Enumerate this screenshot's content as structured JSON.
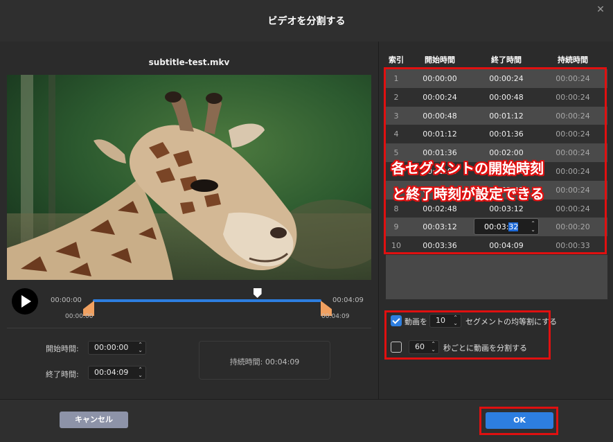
{
  "dialog": {
    "title": "ビデオを分割する",
    "close_glyph": "✕"
  },
  "preview": {
    "filename": "subtitle-test.mkv",
    "timeline_start": "00:00:00",
    "timeline_end": "00:04:09",
    "handle_start": "00:00:00",
    "handle_end": "00:04:09",
    "playhead_position": 0.72
  },
  "fields": {
    "start_label": "開始時間:",
    "start_value": "00:00:00",
    "end_label": "終了時間:",
    "end_value": "00:04:09",
    "duration_label": "持続時間:",
    "duration_value": "00:04:09"
  },
  "table": {
    "headers": [
      "索引",
      "開始時間",
      "終了時間",
      "持続時間"
    ],
    "rows": [
      {
        "idx": "1",
        "start": "00:00:00",
        "end": "00:00:24",
        "dur": "00:00:24"
      },
      {
        "idx": "2",
        "start": "00:00:24",
        "end": "00:00:48",
        "dur": "00:00:24"
      },
      {
        "idx": "3",
        "start": "00:00:48",
        "end": "00:01:12",
        "dur": "00:00:24"
      },
      {
        "idx": "4",
        "start": "00:01:12",
        "end": "00:01:36",
        "dur": "00:00:24"
      },
      {
        "idx": "5",
        "start": "00:01:36",
        "end": "00:02:00",
        "dur": "00:00:24"
      },
      {
        "idx": "6",
        "start": "00:02:00",
        "end": "00:02:24",
        "dur": "00:00:24"
      },
      {
        "idx": "7",
        "start": "00:02:24",
        "end": "00:02:48",
        "dur": "00:00:24"
      },
      {
        "idx": "8",
        "start": "00:02:48",
        "end": "00:03:12",
        "dur": "00:00:24"
      },
      {
        "idx": "9",
        "start": "00:03:12",
        "end": "00:03:32",
        "dur": "00:00:20"
      },
      {
        "idx": "10",
        "start": "00:03:36",
        "end": "00:04:09",
        "dur": "00:00:33"
      }
    ],
    "edit_value_prefix": "00:03:",
    "edit_value_selected": "32"
  },
  "annotation": {
    "line1": "各セグメントの開始時刻",
    "line2": "と終了時刻が設定できる"
  },
  "options": {
    "split_equal_prefix": "動画を",
    "split_equal_count": "10",
    "split_equal_suffix": "セグメントの均等割にする",
    "split_equal_checked": true,
    "split_interval_count": "60",
    "split_interval_suffix": "秒ごとに動画を分割する",
    "split_interval_checked": false
  },
  "buttons": {
    "cancel": "キャンセル",
    "ok": "OK"
  },
  "colors": {
    "accent": "#2d7ee0",
    "highlight": "#e01010",
    "handle": "#f0a060"
  }
}
